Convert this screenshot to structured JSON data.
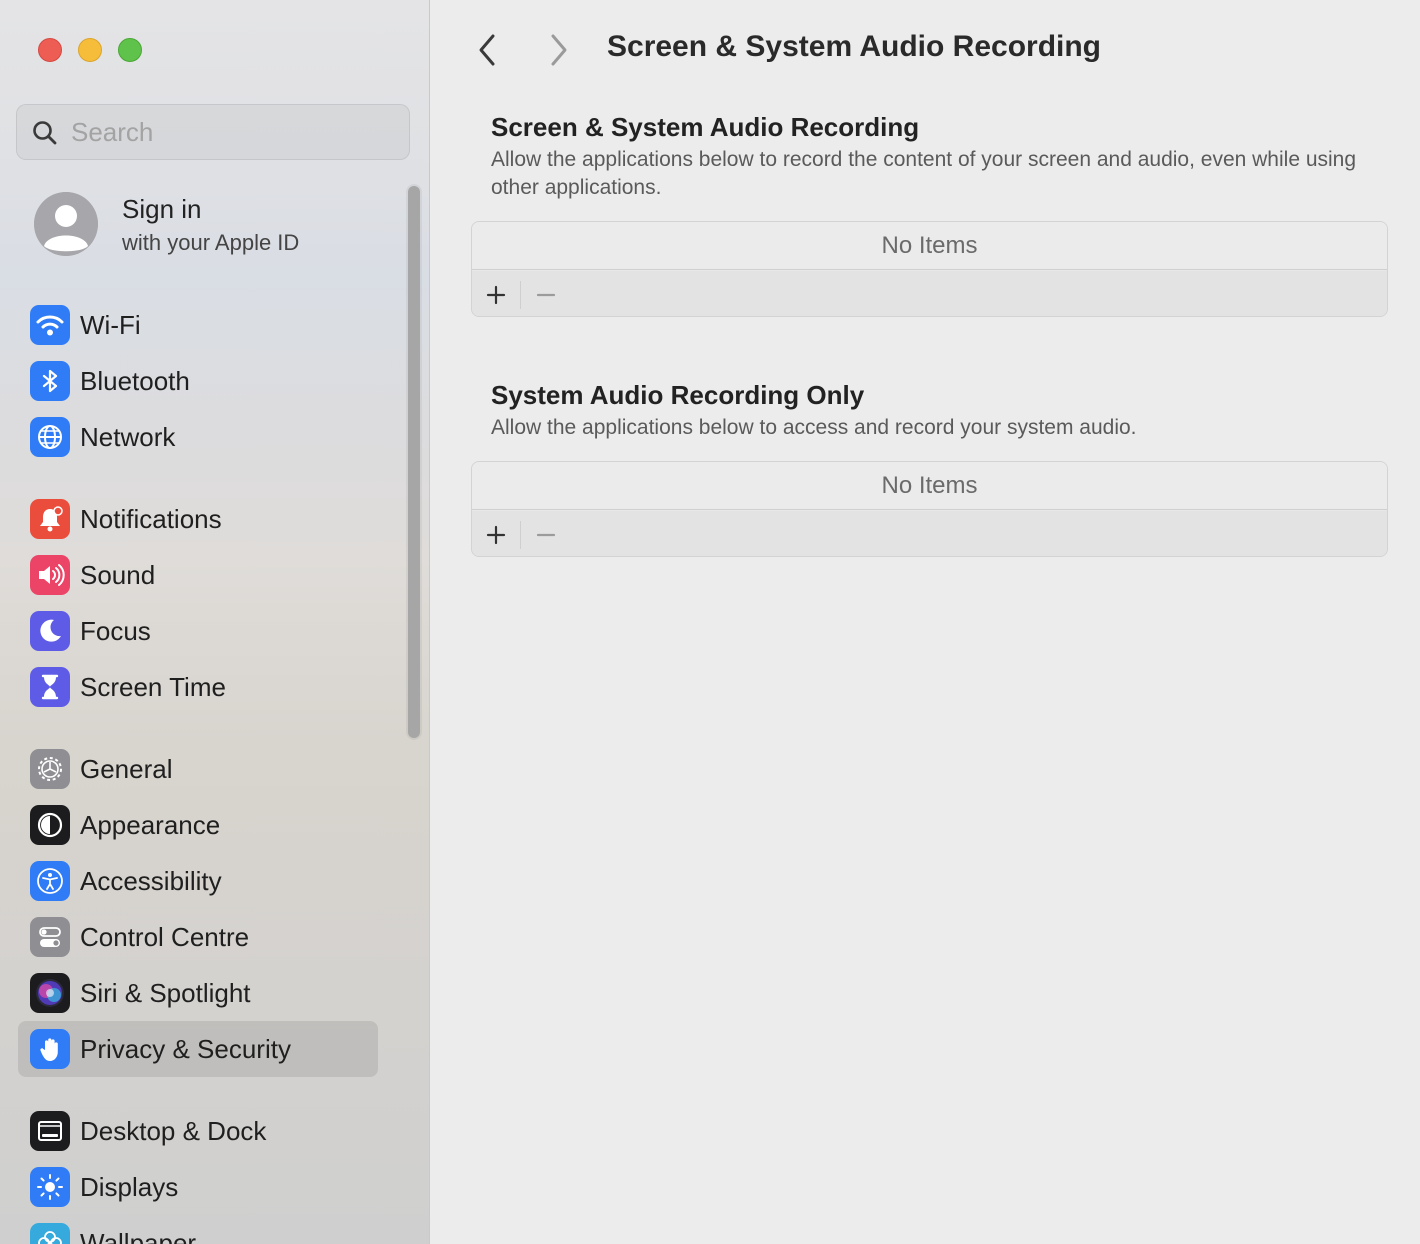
{
  "window": {
    "title": "Screen & System Audio Recording"
  },
  "sidebar": {
    "search": {
      "placeholder": "Search",
      "value": ""
    },
    "account": {
      "title": "Sign in",
      "subtitle": "with your Apple ID"
    },
    "items": [
      {
        "label": "Wi-Fi",
        "icon": "wifi-icon",
        "color": "#2f7cf6"
      },
      {
        "label": "Bluetooth",
        "icon": "bluetooth-icon",
        "color": "#2f7cf6"
      },
      {
        "label": "Network",
        "icon": "globe-icon",
        "color": "#2f7cf6"
      },
      {
        "label": "Notifications",
        "icon": "bell-icon",
        "color": "#eb4d3d"
      },
      {
        "label": "Sound",
        "icon": "speaker-icon",
        "color": "#eb4466"
      },
      {
        "label": "Focus",
        "icon": "moon-icon",
        "color": "#5e5ce6"
      },
      {
        "label": "Screen Time",
        "icon": "hourglass-icon",
        "color": "#5e5ce6"
      },
      {
        "label": "General",
        "icon": "gear-icon",
        "color": "#8e8e93"
      },
      {
        "label": "Appearance",
        "icon": "appearance-icon",
        "color": "#1c1c1e"
      },
      {
        "label": "Accessibility",
        "icon": "accessibility-icon",
        "color": "#2f7cf6"
      },
      {
        "label": "Control Centre",
        "icon": "control-centre-icon",
        "color": "#8e8e93"
      },
      {
        "label": "Siri & Spotlight",
        "icon": "siri-icon",
        "color": "#1c1c1e"
      },
      {
        "label": "Privacy & Security",
        "icon": "hand-icon",
        "color": "#2f7cf6",
        "selected": true
      },
      {
        "label": "Desktop & Dock",
        "icon": "dock-icon",
        "color": "#1c1c1e"
      },
      {
        "label": "Displays",
        "icon": "sun-icon",
        "color": "#2f7cf6"
      },
      {
        "label": "Wallpaper",
        "icon": "flower-icon",
        "color": "#36aadc"
      }
    ]
  },
  "main": {
    "title": "Screen & System Audio Recording",
    "sections": [
      {
        "title": "Screen & System Audio Recording",
        "description": "Allow the applications below to record the content of your screen and audio, even while using other applications.",
        "empty_text": "No Items"
      },
      {
        "title": "System Audio Recording Only",
        "description": "Allow the applications below to access and record your system audio.",
        "empty_text": "No Items"
      }
    ]
  }
}
